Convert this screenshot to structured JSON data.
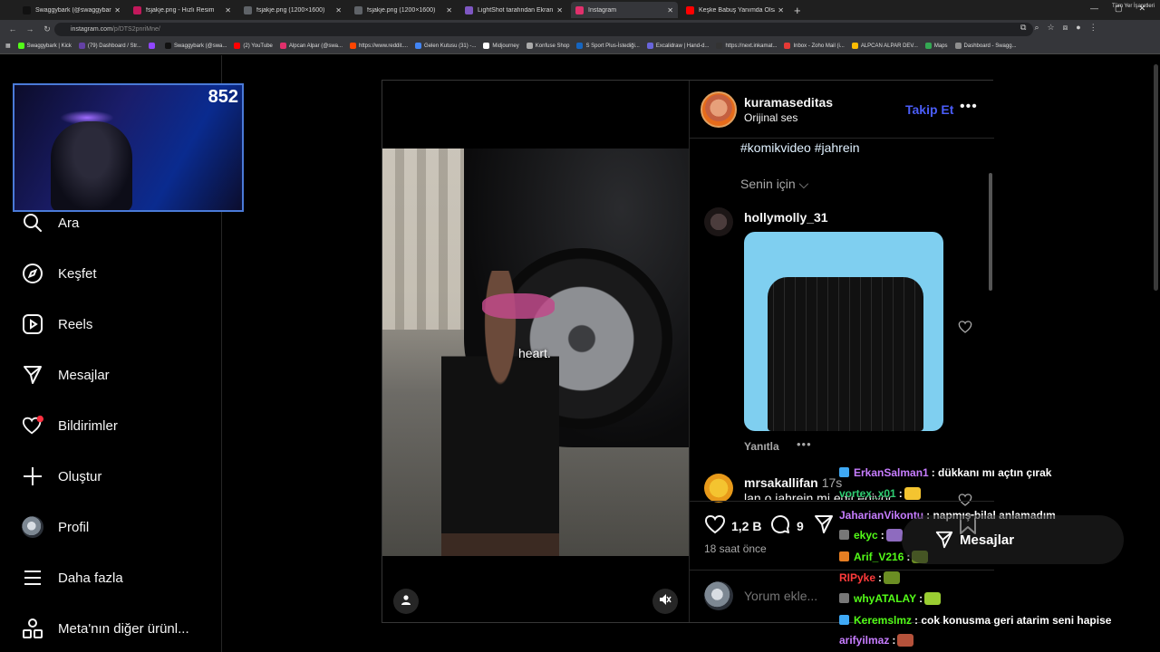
{
  "browser": {
    "tabs": [
      {
        "label": "Swaggybark (@swaggybark) / X",
        "color": "#111111",
        "active": false
      },
      {
        "label": "fsjakje.png - Hızlı Resim",
        "color": "#c2185b",
        "active": false
      },
      {
        "label": "fsjakje.png (1200×1600)",
        "color": "#5f6368",
        "active": false
      },
      {
        "label": "fsjakje.png (1200×1600)",
        "color": "#5f6368",
        "active": false
      },
      {
        "label": "LightShot tarafından Ekran Gör...",
        "color": "#7e57c2",
        "active": false
      },
      {
        "label": "Instagram",
        "color": "#e1306c",
        "active": true
      },
      {
        "label": "Keşke Babuş Yanımda Olsa... (S...",
        "color": "#ff0000",
        "active": false
      }
    ],
    "url_host": "instagram.com",
    "url_path": "/p/DTS2pnriMne/",
    "bookmarks": [
      {
        "label": "Swaggybark | Kick",
        "color": "#53fc18"
      },
      {
        "label": "(79) Dashboard / Str...",
        "color": "#6441a5"
      },
      {
        "label": "",
        "color": "#9146ff"
      },
      {
        "label": "Swaggybark (@swa...",
        "color": "#111111"
      },
      {
        "label": "(2) YouTube",
        "color": "#ff0000"
      },
      {
        "label": "Alpcan Alpar (@swa...",
        "color": "#e1306c"
      },
      {
        "label": "https://www.reddit....",
        "color": "#ff4500"
      },
      {
        "label": "Gelen Kutusu (31) -...",
        "color": "#4285f4"
      },
      {
        "label": "Midjourney",
        "color": "#ffffff"
      },
      {
        "label": "Konfuse Shop",
        "color": "#aaaaaa"
      },
      {
        "label": "S Sport Plus-İstediği...",
        "color": "#1565c0"
      },
      {
        "label": "Excalidraw | Hand-d...",
        "color": "#6965db"
      },
      {
        "label": "https://next.inkamat...",
        "color": "#333333"
      },
      {
        "label": "Inbox - Zoho Mail (i...",
        "color": "#e53935"
      },
      {
        "label": "ALPCAN ALPAR DEV...",
        "color": "#fbbc04"
      },
      {
        "label": "Maps",
        "color": "#34a853"
      },
      {
        "label": "Dashboard - Swagg...",
        "color": "#8e8e8e"
      }
    ],
    "all_bookmarks": "Tüm Yer İşaretleri"
  },
  "webcam": {
    "viewer_count": "852"
  },
  "sidebar": {
    "items": [
      {
        "label": "Ara",
        "icon": "search-icon",
        "top": 0
      },
      {
        "label": "Keşfet",
        "icon": "compass-icon"
      },
      {
        "label": "Reels",
        "icon": "reels-icon"
      },
      {
        "label": "Mesajlar",
        "icon": "messages-icon"
      },
      {
        "label": "Bildirimler",
        "icon": "heart-icon"
      },
      {
        "label": "Oluştur",
        "icon": "plus-icon"
      },
      {
        "label": "Profil",
        "icon": "profile-icon"
      },
      {
        "label": "Daha fazla",
        "icon": "menu-icon"
      },
      {
        "label": "Meta'nın diğer ürünl...",
        "icon": "apps-icon"
      }
    ]
  },
  "post": {
    "video_subtitle": "heart.",
    "author": "kuramaseditas",
    "audio": "Orijinal ses",
    "follow": "Takip Et",
    "hashtags": "#komikvideo #jahrein",
    "sort_label": "Senin için",
    "comments": [
      {
        "user": "hollymolly_31",
        "reply_label": "Yanıtla"
      },
      {
        "user": "mrsakallifan",
        "time": "17s",
        "text": "lan o jahrein mi edit ediyor"
      }
    ],
    "likes": "1,2 B",
    "comment_count": "9",
    "time_ago": "18 saat önce",
    "comment_placeholder": "Yorum ekle..."
  },
  "chat": [
    {
      "user": "ErkanSalman1",
      "user_color": "#c77dff",
      "text": ": dükkanı mı açtın çırak",
      "badge": "#3fa9f5"
    },
    {
      "user": "vortex_x01",
      "user_color": "#2ecc71",
      "text": ":",
      "badge": "",
      "emote": "#f4c430"
    },
    {
      "user": "JaharianVikontu",
      "user_color": "#c77dff",
      "text": ": napmış bilal anlamadım",
      "badge": ""
    },
    {
      "user": "ekyc",
      "user_color": "#53fc18",
      "text": ":",
      "badge": "#777777",
      "emote": "#8e6bbf"
    },
    {
      "user": "Arif_V216",
      "user_color": "#53fc18",
      "text": ":",
      "badge": "#e67e22",
      "emote": "#6b8e23"
    },
    {
      "user": "RIPyke",
      "user_color": "#ff3b3b",
      "text": ":",
      "badge": "",
      "emote": "#6b8e23"
    },
    {
      "user": "whyATALAY",
      "user_color": "#53fc18",
      "text": ":",
      "badge": "#777777",
      "emote": "#9acd32"
    },
    {
      "user": "Keremslmz",
      "user_color": "#53fc18",
      "text": ": cok konusma geri atarim seni hapise",
      "badge": "#3fa9f5"
    },
    {
      "user": "arifyilmaz",
      "user_color": "#c77dff",
      "text": ":",
      "badge": "",
      "emote": "#b5523b"
    }
  ],
  "messages_pill": "Mesajlar"
}
